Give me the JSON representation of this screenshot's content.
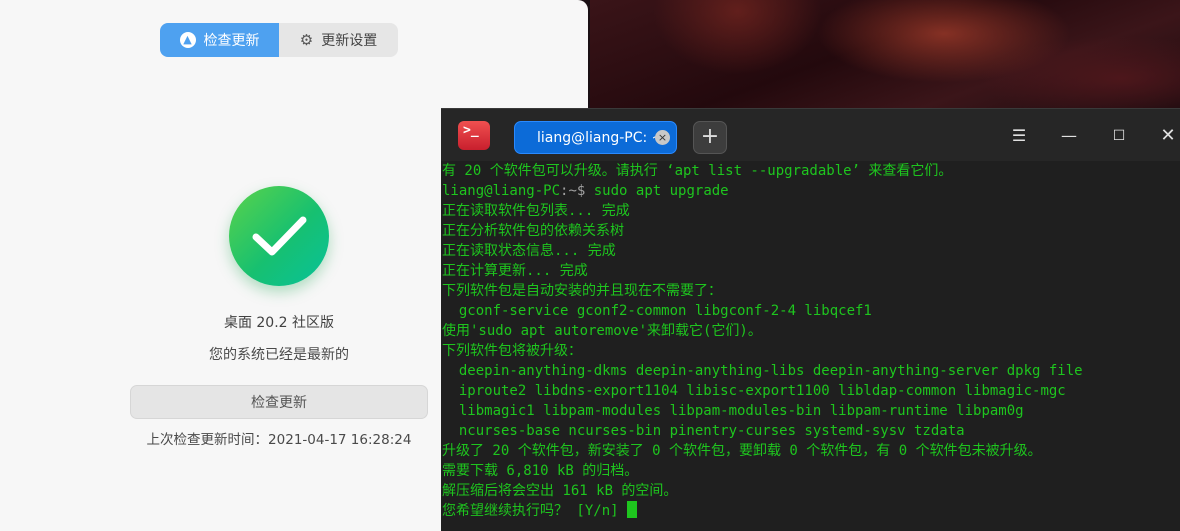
{
  "control_center": {
    "tabs": [
      {
        "label": "检查更新",
        "icon": "arrow-up-circle-icon",
        "active": true
      },
      {
        "label": "更新设置",
        "icon": "gear-icon",
        "active": false
      }
    ],
    "status_icon": "checkmark-icon",
    "edition": "桌面 20.2 社区版",
    "status": "您的系统已经是最新的",
    "check_button": "检查更新",
    "last_check": "上次检查更新时间：2021-04-17 16:28:24"
  },
  "terminal": {
    "tab_title": "liang@liang-PC: ~",
    "new_tab_label": "+",
    "window_controls": [
      "menu-icon",
      "minimize-icon",
      "maximize-icon",
      "close-icon"
    ],
    "prompt_user": "liang@liang-PC",
    "prompt_path": ":~$",
    "command": " sudo apt upgrade",
    "lines": [
      "有 20 个软件包可以升级。请执行 ‘apt list --upgradable’ 来查看它们。",
      "正在读取软件包列表... 完成",
      "正在分析软件包的依赖关系树",
      "正在读取状态信息... 完成",
      "正在计算更新... 完成",
      "下列软件包是自动安装的并且现在不需要了：",
      "  gconf-service gconf2-common libgconf-2-4 libqcef1",
      "使用'sudo apt autoremove'来卸载它(它们)。",
      "下列软件包将被升级：",
      "  deepin-anything-dkms deepin-anything-libs deepin-anything-server dpkg file",
      "  iproute2 libdns-export1104 libisc-export1100 libldap-common libmagic-mgc",
      "  libmagic1 libpam-modules libpam-modules-bin libpam-runtime libpam0g",
      "  ncurses-base ncurses-bin pinentry-curses systemd-sysv tzdata",
      "升级了 20 个软件包，新安装了 0 个软件包，要卸载 0 个软件包，有 0 个软件包未被升级。",
      "需要下载 6,810 kB 的归档。",
      "解压缩后将会空出 161 kB 的空间。",
      "您希望继续执行吗？ [Y/n] "
    ]
  }
}
